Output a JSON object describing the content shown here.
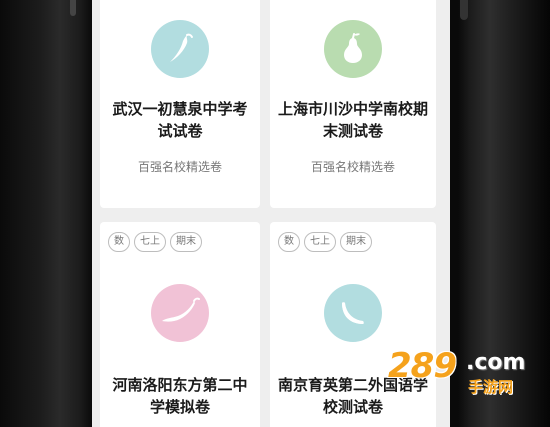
{
  "cards": [
    {
      "title": "武汉一初慧泉中学考试试卷",
      "subtitle": "百强名校精选卷",
      "icon": "chili-pepper-icon",
      "icon_color": "#b2dde0",
      "tags": []
    },
    {
      "title": "上海市川沙中学南校期末测试卷",
      "subtitle": "百强名校精选卷",
      "icon": "pear-icon",
      "icon_color": "#b9dcb0",
      "tags": []
    },
    {
      "title": "河南洛阳东方第二中学模拟卷",
      "subtitle": "",
      "icon": "chili-pepper-icon",
      "icon_color": "#f1c2d6",
      "tags": [
        "数",
        "七上",
        "期末"
      ]
    },
    {
      "title": "南京育英第二外国语学校测试卷",
      "subtitle": "",
      "icon": "cucumber-slice-icon",
      "icon_color": "#b2dde0",
      "tags": [
        "数",
        "七上",
        "期末"
      ]
    }
  ],
  "watermark": {
    "digits": "289",
    "domain": ".com",
    "sub": "手游网"
  }
}
